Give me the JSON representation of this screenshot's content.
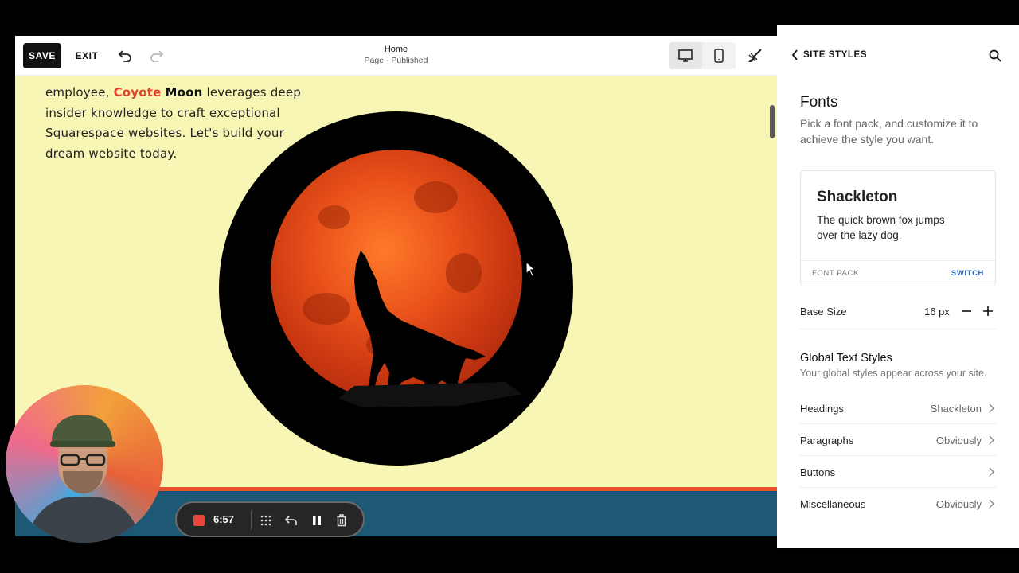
{
  "toolbar": {
    "save_label": "SAVE",
    "exit_label": "EXIT",
    "page_title": "Home",
    "page_status": "Page · Published"
  },
  "canvas": {
    "copy_before": "employee, ",
    "brand_first": "Coyote",
    "brand_space": " ",
    "brand_second": "Moon",
    "copy_after": " leverages deep insider knowledge to craft exceptional Squarespace websites. Let's build your dream website today.",
    "colors": {
      "background": "#f8f6b4",
      "accent": "#e0452b",
      "footer": "#1d5874"
    }
  },
  "recorder": {
    "time": "6:57"
  },
  "panel": {
    "back_label": "SITE STYLES",
    "fonts_title": "Fonts",
    "fonts_desc": "Pick a font pack, and customize it to achieve the style you want.",
    "card": {
      "font_name": "Shackleton",
      "sample": "The quick brown fox jumps over the lazy dog.",
      "footer_label": "FONT PACK",
      "switch_label": "SWITCH"
    },
    "base_size": {
      "label": "Base Size",
      "value": "16 px"
    },
    "global_styles": {
      "title": "Global Text Styles",
      "desc": "Your global styles appear across your site.",
      "rows": [
        {
          "label": "Headings",
          "value": "Shackleton"
        },
        {
          "label": "Paragraphs",
          "value": "Obviously"
        },
        {
          "label": "Buttons",
          "value": ""
        },
        {
          "label": "Miscellaneous",
          "value": "Obviously"
        }
      ]
    }
  },
  "icons": {
    "undo": "undo-icon",
    "redo": "redo-icon",
    "desktop": "desktop-icon",
    "mobile": "mobile-icon",
    "style_brush": "paintbrush-icon",
    "back": "chevron-left-icon",
    "search": "search-icon"
  }
}
